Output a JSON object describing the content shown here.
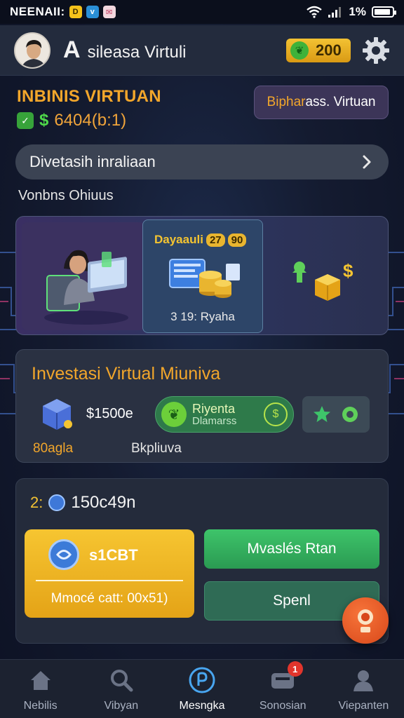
{
  "status_bar": {
    "carrier": "NEENAII:",
    "battery_text": "1%",
    "battery_level": 0.9
  },
  "header": {
    "title_letter": "A",
    "title": "sileasa Virtuli",
    "coin_value": "200"
  },
  "balance": {
    "title": "INBINIS VIRTUAN",
    "dollar_sign": "$",
    "value": "6404(b:1)",
    "action_button_highlight": "Biphar",
    "action_button_rest": "ass. Virtuan"
  },
  "search": {
    "label": "Divetasih inraliaan"
  },
  "section": {
    "label": "Vonbns Ohiuus"
  },
  "banner": {
    "mid_title": "Dayaauli",
    "mid_pill_1": "27",
    "mid_pill_2": "90",
    "mid_footer": "3 19: Ryaha"
  },
  "investment": {
    "title": "Investasi Virtual Miuniva",
    "price": "$1500e",
    "pill_title": "Riyenta",
    "pill_subtitle": "Dlamarss",
    "sub_left": "80agla",
    "sub_right": "Bkpliuva"
  },
  "wallet": {
    "prefix": "2:",
    "value": "150c49n",
    "gold_label": "s1CBT",
    "gold_sub": "Mmocé catt: 00x51)",
    "btn1": "Mvaslés Rtan",
    "btn2": "Spenl"
  },
  "nav": {
    "items": [
      {
        "label": "Nebilis"
      },
      {
        "label": "Vibyan"
      },
      {
        "label": "Mesngka"
      },
      {
        "label": "Sonosian",
        "badge": "1"
      },
      {
        "label": "Viepanten"
      }
    ]
  },
  "colors": {
    "accent_orange": "#f2a62b",
    "accent_green": "#3ec46a",
    "gold": "#f6c531",
    "background": "#141b30"
  }
}
